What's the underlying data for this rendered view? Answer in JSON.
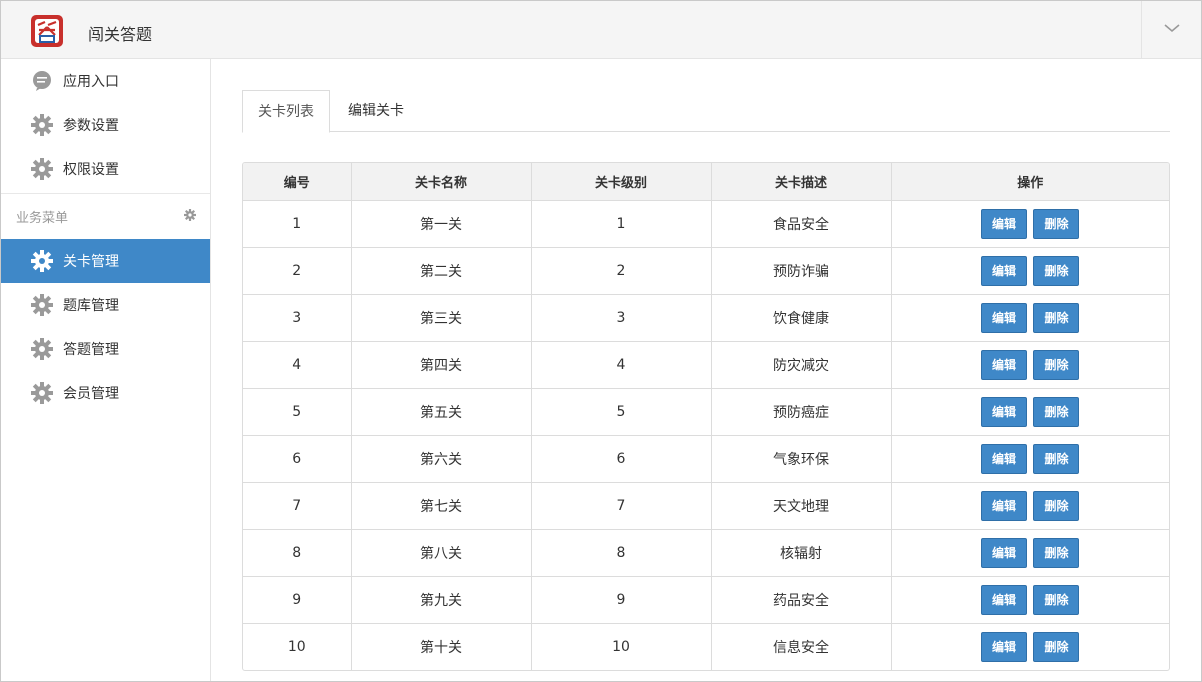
{
  "app": {
    "title": "闯关答题",
    "logo_text": "答"
  },
  "sidebar": {
    "top_items": [
      {
        "label": "应用入口",
        "icon": "chat-icon"
      },
      {
        "label": "参数设置",
        "icon": "gear-icon"
      },
      {
        "label": "权限设置",
        "icon": "gear-icon"
      }
    ],
    "section_label": "业务菜单",
    "section_items": [
      {
        "label": "关卡管理",
        "icon": "gear-icon",
        "active": true
      },
      {
        "label": "题库管理",
        "icon": "gear-icon"
      },
      {
        "label": "答题管理",
        "icon": "gear-icon"
      },
      {
        "label": "会员管理",
        "icon": "gear-icon"
      }
    ]
  },
  "tabs": [
    {
      "label": "关卡列表",
      "active": true
    },
    {
      "label": "编辑关卡"
    }
  ],
  "table": {
    "headers": [
      "编号",
      "关卡名称",
      "关卡级别",
      "关卡描述",
      "操作"
    ],
    "rows": [
      {
        "id": "1",
        "name": "第一关",
        "level": "1",
        "desc": "食品安全"
      },
      {
        "id": "2",
        "name": "第二关",
        "level": "2",
        "desc": "预防诈骗"
      },
      {
        "id": "3",
        "name": "第三关",
        "level": "3",
        "desc": "饮食健康"
      },
      {
        "id": "4",
        "name": "第四关",
        "level": "4",
        "desc": "防灾减灾"
      },
      {
        "id": "5",
        "name": "第五关",
        "level": "5",
        "desc": "预防癌症"
      },
      {
        "id": "6",
        "name": "第六关",
        "level": "6",
        "desc": "气象环保"
      },
      {
        "id": "7",
        "name": "第七关",
        "level": "7",
        "desc": "天文地理"
      },
      {
        "id": "8",
        "name": "第八关",
        "level": "8",
        "desc": "核辐射"
      },
      {
        "id": "9",
        "name": "第九关",
        "level": "9",
        "desc": "药品安全"
      },
      {
        "id": "10",
        "name": "第十关",
        "level": "10",
        "desc": "信息安全"
      }
    ],
    "edit_label": "编辑",
    "delete_label": "删除"
  },
  "colors": {
    "accent": "#3f88c8",
    "header_bg": "#f5f5f5",
    "table_head_bg": "#f2f2f2"
  }
}
